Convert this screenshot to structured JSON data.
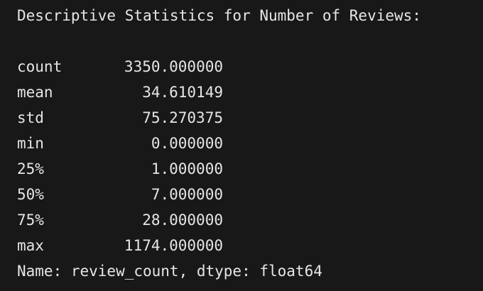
{
  "output": {
    "title": "Descriptive Statistics for Number of Reviews:",
    "stats": [
      {
        "label": "count",
        "value": "3350.000000"
      },
      {
        "label": "mean",
        "value": "34.610149"
      },
      {
        "label": "std",
        "value": "75.270375"
      },
      {
        "label": "min",
        "value": "0.000000"
      },
      {
        "label": "25%",
        "value": "1.000000"
      },
      {
        "label": "50%",
        "value": "7.000000"
      },
      {
        "label": "75%",
        "value": "28.000000"
      },
      {
        "label": "max",
        "value": "1174.000000"
      }
    ],
    "footer": "Name: review_count, dtype: float64"
  }
}
